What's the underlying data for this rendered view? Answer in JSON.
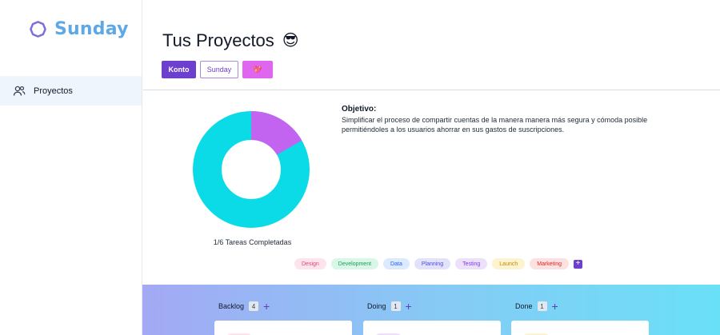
{
  "app": {
    "name": "Sunday"
  },
  "sidebar": {
    "items": [
      {
        "label": "Proyectos",
        "icon": "users-icon"
      }
    ]
  },
  "header": {
    "title": "Tus Proyectos",
    "title_emoji": "😎",
    "buttons": {
      "konto": "Konto",
      "sunday": "Sunday",
      "heart": "💖"
    }
  },
  "progress": {
    "completed": 1,
    "total": 6,
    "caption": "1/6 Tareas Completadas",
    "colors": {
      "completed": "#c264f0",
      "remaining": "#0bdbe6"
    }
  },
  "objective": {
    "heading": "Objetivo:",
    "text": "Simplificar el proceso de compartir cuentas de la manera manera más segura y cómoda posible permitiéndoles a los usuarios ahorrar en sus gastos de suscripciones."
  },
  "tags": [
    {
      "label": "Design",
      "bg": "#fde4ec",
      "fg": "#d9467a"
    },
    {
      "label": "Development",
      "bg": "#d9f7e6",
      "fg": "#1f9d5c"
    },
    {
      "label": "Data",
      "bg": "#dbeafe",
      "fg": "#2563eb"
    },
    {
      "label": "Planning",
      "bg": "#e2e3fb",
      "fg": "#4f46e5"
    },
    {
      "label": "Testing",
      "bg": "#ece0fb",
      "fg": "#7c3aed"
    },
    {
      "label": "Launch",
      "bg": "#fdf3cf",
      "fg": "#c08a05"
    },
    {
      "label": "Marketing",
      "bg": "#fde1e1",
      "fg": "#dc2626"
    }
  ],
  "board": {
    "columns": [
      {
        "title": "Backlog",
        "count": "4",
        "card_tag": "Design",
        "card_tag_bg": "#fde4ec",
        "card_tag_fg": "#d9467a"
      },
      {
        "title": "Doing",
        "count": "1",
        "card_tag": "Testing",
        "card_tag_bg": "#ece0fb",
        "card_tag_fg": "#7c3aed"
      },
      {
        "title": "Done",
        "count": "1",
        "card_tag": "Launch",
        "card_tag_bg": "#fdf3cf",
        "card_tag_fg": "#c08a05"
      }
    ]
  }
}
